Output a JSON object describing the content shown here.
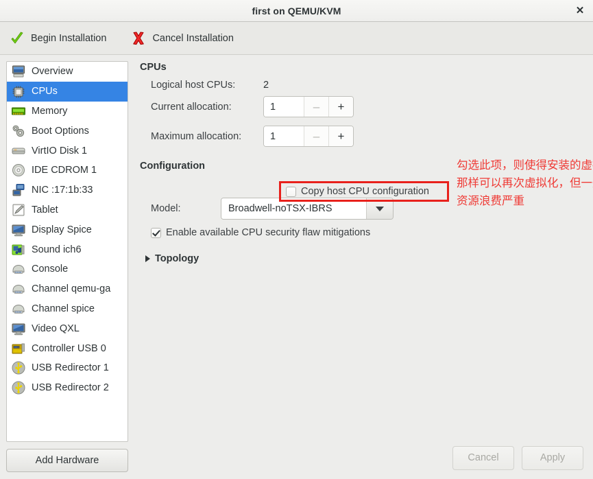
{
  "window": {
    "title": "first on QEMU/KVM",
    "close_label": "✕"
  },
  "toolbar": {
    "begin_label": "Begin Installation",
    "cancel_label": "Cancel Installation"
  },
  "sidebar": {
    "items": [
      {
        "label": "Overview",
        "icon": "computer-icon",
        "selected": false
      },
      {
        "label": "CPUs",
        "icon": "cpu-chip-icon",
        "selected": true
      },
      {
        "label": "Memory",
        "icon": "memory-ram-icon",
        "selected": false
      },
      {
        "label": "Boot Options",
        "icon": "gears-icon",
        "selected": false
      },
      {
        "label": "VirtIO Disk 1",
        "icon": "harddisk-icon",
        "selected": false
      },
      {
        "label": "IDE CDROM 1",
        "icon": "optical-disc-icon",
        "selected": false
      },
      {
        "label": "NIC :17:1b:33",
        "icon": "network-card-icon",
        "selected": false
      },
      {
        "label": "Tablet",
        "icon": "tablet-pen-icon",
        "selected": false
      },
      {
        "label": "Display Spice",
        "icon": "monitor-icon",
        "selected": false
      },
      {
        "label": "Sound ich6",
        "icon": "sound-card-icon",
        "selected": false
      },
      {
        "label": "Console",
        "icon": "console-serial-icon",
        "selected": false
      },
      {
        "label": "Channel qemu-ga",
        "icon": "console-serial-icon",
        "selected": false
      },
      {
        "label": "Channel spice",
        "icon": "console-serial-icon",
        "selected": false
      },
      {
        "label": "Video QXL",
        "icon": "monitor-icon",
        "selected": false
      },
      {
        "label": "Controller USB 0",
        "icon": "controller-card-icon",
        "selected": false
      },
      {
        "label": "USB Redirector 1",
        "icon": "usb-icon",
        "selected": false
      },
      {
        "label": "USB Redirector 2",
        "icon": "usb-icon",
        "selected": false
      }
    ],
    "add_hardware_label": "Add Hardware"
  },
  "main": {
    "cpus_heading": "CPUs",
    "logical_host_cpus_label": "Logical host CPUs:",
    "logical_host_cpus_value": "2",
    "current_allocation_label": "Current allocation:",
    "current_allocation_value": "1",
    "maximum_allocation_label": "Maximum allocation:",
    "maximum_allocation_value": "1",
    "spin_minus": "–",
    "spin_plus": "+",
    "configuration_heading": "Configuration",
    "copy_host_cpu_label": "Copy host CPU configuration",
    "copy_host_cpu_checked": false,
    "model_label": "Model:",
    "model_value": "Broadwell-noTSX-IBRS",
    "mitigations_label": "Enable available CPU security flaw mitigations",
    "mitigations_checked": true,
    "topology_label": "Topology",
    "annotation_text": "勾选此项，则使得安装的虚拟机像宿主机\n那样可以再次虚拟化，但一般不这样用，\n资源浪费严重"
  },
  "footer": {
    "cancel_label": "Cancel",
    "apply_label": "Apply"
  },
  "colors": {
    "selection_blue": "#3584e4",
    "annotation_red": "#ef3b36",
    "highlight_box_red": "#e8211c",
    "window_bg": "#ededeb"
  }
}
